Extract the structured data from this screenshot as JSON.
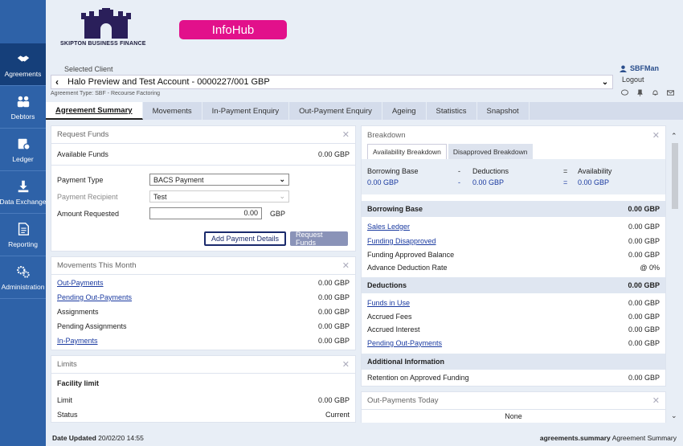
{
  "brand": {
    "name": "SKIPTON BUSINESS FINANCE",
    "app_badge": "InfoHub"
  },
  "sidebar": {
    "items": [
      {
        "label": "Agreements",
        "icon": "handshake-icon"
      },
      {
        "label": "Debtors",
        "icon": "people-icon"
      },
      {
        "label": "Ledger",
        "icon": "ledger-icon"
      },
      {
        "label": "Data Exchange",
        "icon": "download-icon"
      },
      {
        "label": "Reporting",
        "icon": "report-icon"
      },
      {
        "label": "Administration",
        "icon": "gears-icon"
      }
    ]
  },
  "header": {
    "selected_client_label": "Selected Client",
    "client_name": "Halo Preview and Test Account - 0000227/001 GBP",
    "agreement_type": "Agreement Type: SBF - Recourse Factoring",
    "user": "SBFMan",
    "logout": "Logout"
  },
  "tabs": [
    "Agreement Summary",
    "Movements",
    "In-Payment Enquiry",
    "Out-Payment Enquiry",
    "Ageing",
    "Statistics",
    "Snapshot"
  ],
  "request_funds": {
    "title": "Request Funds",
    "available_label": "Available Funds",
    "available_value": "0.00 GBP",
    "payment_type_label": "Payment Type",
    "payment_type_value": "BACS Payment",
    "recipient_label": "Payment Recipient",
    "recipient_value": "Test",
    "amount_label": "Amount Requested",
    "amount_value": "0.00",
    "currency": "GBP",
    "add_details_btn": "Add Payment Details",
    "request_btn": "Request Funds"
  },
  "movements": {
    "title": "Movements This Month",
    "rows": [
      {
        "label": "Out-Payments",
        "value": "0.00 GBP",
        "link": true
      },
      {
        "label": "Pending Out-Payments",
        "value": "0.00 GBP",
        "link": true
      },
      {
        "label": "Assignments",
        "value": "0.00 GBP",
        "link": false
      },
      {
        "label": "Pending Assignments",
        "value": "0.00 GBP",
        "link": false
      },
      {
        "label": "In-Payments",
        "value": "0.00 GBP",
        "link": true
      }
    ]
  },
  "limits": {
    "title": "Limits",
    "facility": "Facility limit",
    "limit_label": "Limit",
    "limit_value": "0.00 GBP",
    "status_label": "Status",
    "status_value": "Current"
  },
  "breakdown": {
    "title": "Breakdown",
    "subtabs": [
      "Availability Breakdown",
      "Disapproved Breakdown"
    ],
    "grid": {
      "h1": "Borrowing Base",
      "op1": "-",
      "h2": "Deductions",
      "op2": "=",
      "h3": "Availability",
      "v1": "0.00 GBP",
      "v2": "0.00 GBP",
      "v3": "0.00 GBP"
    },
    "borrowing_base": {
      "title": "Borrowing Base",
      "total": "0.00 GBP",
      "rows": [
        {
          "label": "Sales Ledger",
          "value": "0.00 GBP",
          "link": true
        },
        {
          "label": "Funding Disapproved",
          "value": "0.00 GBP",
          "link": true
        },
        {
          "label": "Funding Approved Balance",
          "value": "0.00 GBP",
          "link": false
        },
        {
          "label": "Advance Deduction Rate",
          "value": "@ 0%",
          "link": false
        }
      ]
    },
    "deductions": {
      "title": "Deductions",
      "total": "0.00 GBP",
      "rows": [
        {
          "label": "Funds in Use",
          "value": "0.00 GBP",
          "link": true
        },
        {
          "label": "Accrued Fees",
          "value": "0.00 GBP",
          "link": false
        },
        {
          "label": "Accrued Interest",
          "value": "0.00 GBP",
          "link": false
        },
        {
          "label": "Pending Out-Payments",
          "value": "0.00 GBP",
          "link": true
        }
      ]
    },
    "additional": {
      "title": "Additional Information",
      "rows": [
        {
          "label": "Retention on Approved Funding",
          "value": "0.00 GBP"
        }
      ]
    }
  },
  "out_payments_today": {
    "title": "Out-Payments Today",
    "value": "None"
  },
  "footer": {
    "date_label": "Date Updated",
    "date_value": "20/02/20 14:55",
    "page_code": "agreements.summary",
    "page_name": "Agreement Summary"
  },
  "colors": {
    "sidebar": "#2e62a8",
    "sidebar_active": "#153f7a",
    "badge": "#e2108b",
    "link": "#1a3aa0"
  }
}
